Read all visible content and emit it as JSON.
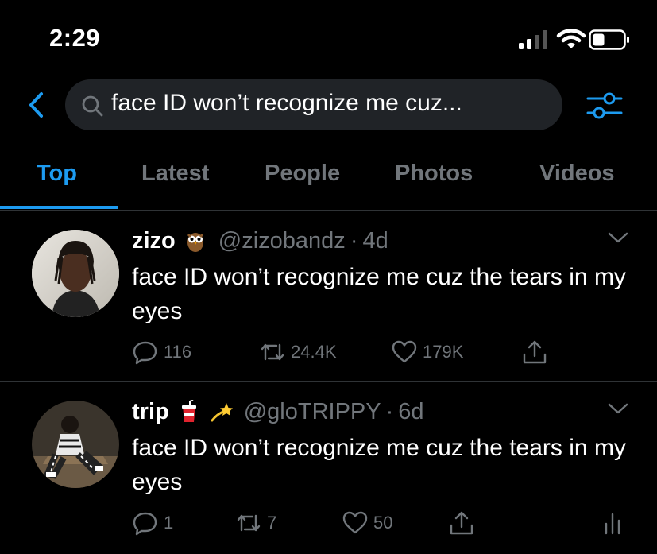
{
  "status_bar": {
    "time": "2:29"
  },
  "search": {
    "query": "face ID won’t recognize me cuz..."
  },
  "tabs": [
    {
      "label": "Top",
      "active": true
    },
    {
      "label": "Latest",
      "active": false
    },
    {
      "label": "People",
      "active": false
    },
    {
      "label": "Photos",
      "active": false
    },
    {
      "label": "Videos",
      "active": false
    }
  ],
  "tweets": [
    {
      "display_name": "zizo",
      "name_emojis": [
        "owl-emoji"
      ],
      "handle": "@zizobandz",
      "time": "4d",
      "text": "face ID won’t recognize me cuz the tears in my eyes",
      "replies": "116",
      "retweets": "24.4K",
      "likes": "179K"
    },
    {
      "display_name": "trip",
      "name_emojis": [
        "cup-with-straw-emoji",
        "dizzy-emoji"
      ],
      "handle": "@gloTRIPPY",
      "time": "6d",
      "text": "face ID won’t recognize me cuz the tears in my eyes",
      "replies": "1",
      "retweets": "7",
      "likes": "50"
    }
  ],
  "colors": {
    "accent": "#1d9bf0",
    "muted": "#71767b",
    "search_bg": "#202327",
    "divider": "#2f3336"
  }
}
